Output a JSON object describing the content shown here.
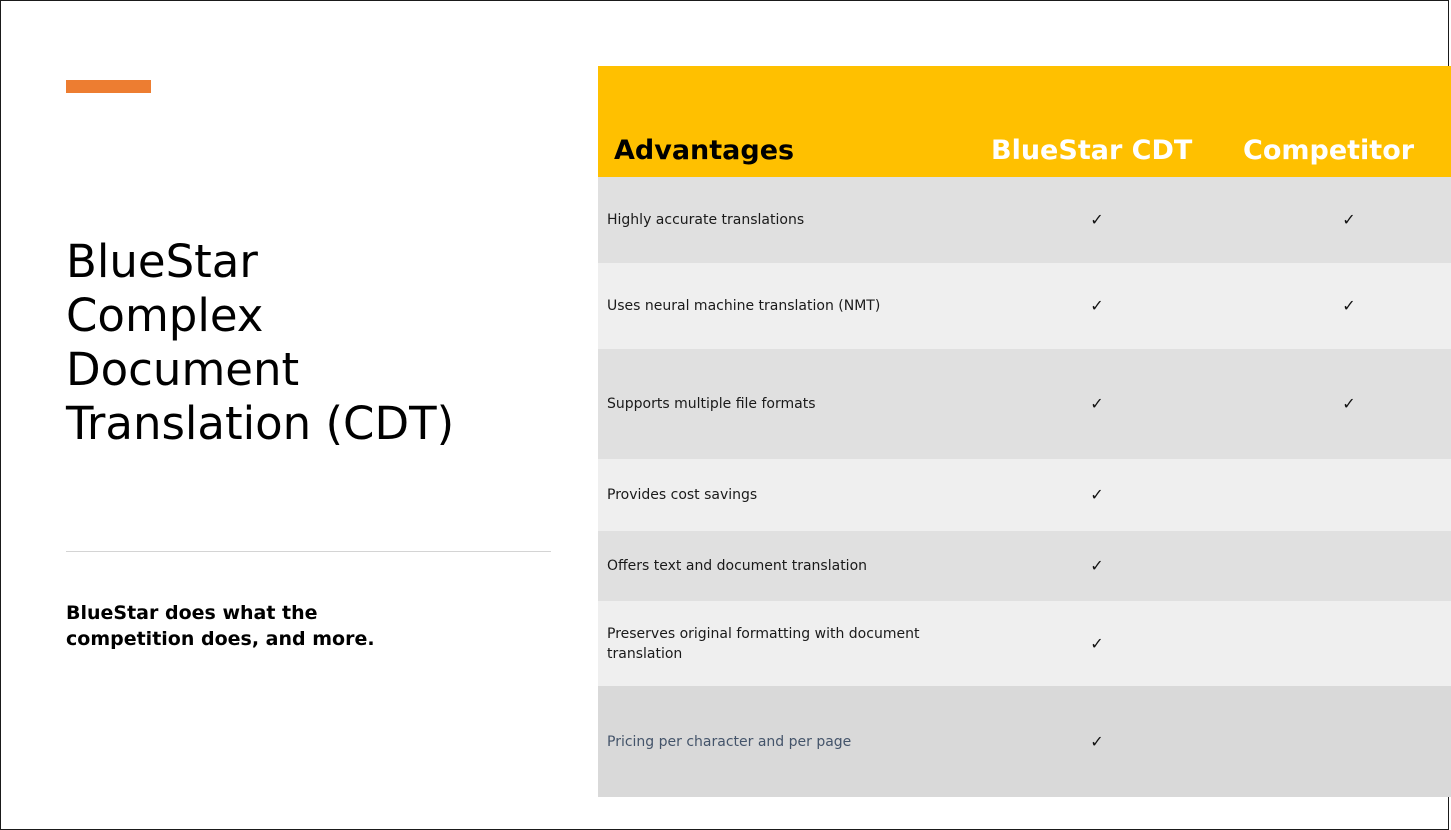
{
  "slide": {
    "title": "BlueStar\nComplex\nDocument\nTranslation (CDT)",
    "subtitle": "BlueStar does what the\ncompetition does, and more."
  },
  "colors": {
    "accent": "#ED7D31",
    "header_bg": "#FFC000",
    "row_dark": "#E0E0E0",
    "row_light": "#EFEFEF",
    "row_last": "#D9D9D9",
    "last_label_text": "#44546A"
  },
  "table": {
    "headers": {
      "advantages": "Advantages",
      "bluestar": "BlueStar CDT",
      "competitor": "Competitor"
    },
    "check_glyph": "✓",
    "rows": [
      {
        "label": "Highly accurate translations",
        "bluestar": "✓",
        "competitor": "✓"
      },
      {
        "label": "Uses neural machine translation (NMT)",
        "bluestar": "✓",
        "competitor": "✓"
      },
      {
        "label": "Supports multiple file formats",
        "bluestar": "✓",
        "competitor": "✓"
      },
      {
        "label": "Provides cost savings",
        "bluestar": "✓",
        "competitor": ""
      },
      {
        "label": "Offers text and document translation",
        "bluestar": "✓",
        "competitor": ""
      },
      {
        "label": "Preserves original formatting with document translation",
        "bluestar": "✓",
        "competitor": ""
      },
      {
        "label": "Pricing per character and per page",
        "bluestar": "✓",
        "competitor": ""
      }
    ]
  }
}
